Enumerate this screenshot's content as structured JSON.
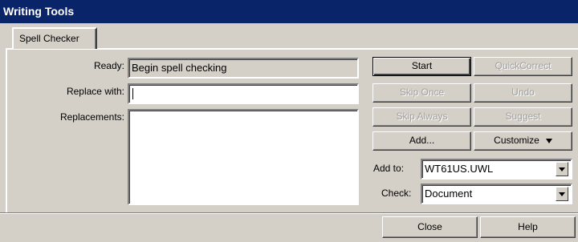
{
  "window": {
    "title": "Writing Tools"
  },
  "tabs": [
    {
      "label": "Spell Checker"
    }
  ],
  "status": {
    "label": "Ready:",
    "value": "Begin spell checking"
  },
  "replace": {
    "label": "Replace with:",
    "value": ""
  },
  "replacements": {
    "label": "Replacements:",
    "items": []
  },
  "buttons": {
    "start": "Start",
    "quick_correct": "QuickCorrect",
    "skip_once": "Skip Once",
    "undo": "Undo",
    "skip_always": "Skip Always",
    "suggest": "Suggest",
    "add": "Add...",
    "customize": "Customize",
    "close": "Close",
    "help": "Help"
  },
  "add_to": {
    "label": "Add to:",
    "value": "WT61US.UWL"
  },
  "check": {
    "label": "Check:",
    "value": "Document"
  },
  "icons": {
    "dropdown": "chevron-down-icon",
    "menu": "triangle-down-icon"
  }
}
